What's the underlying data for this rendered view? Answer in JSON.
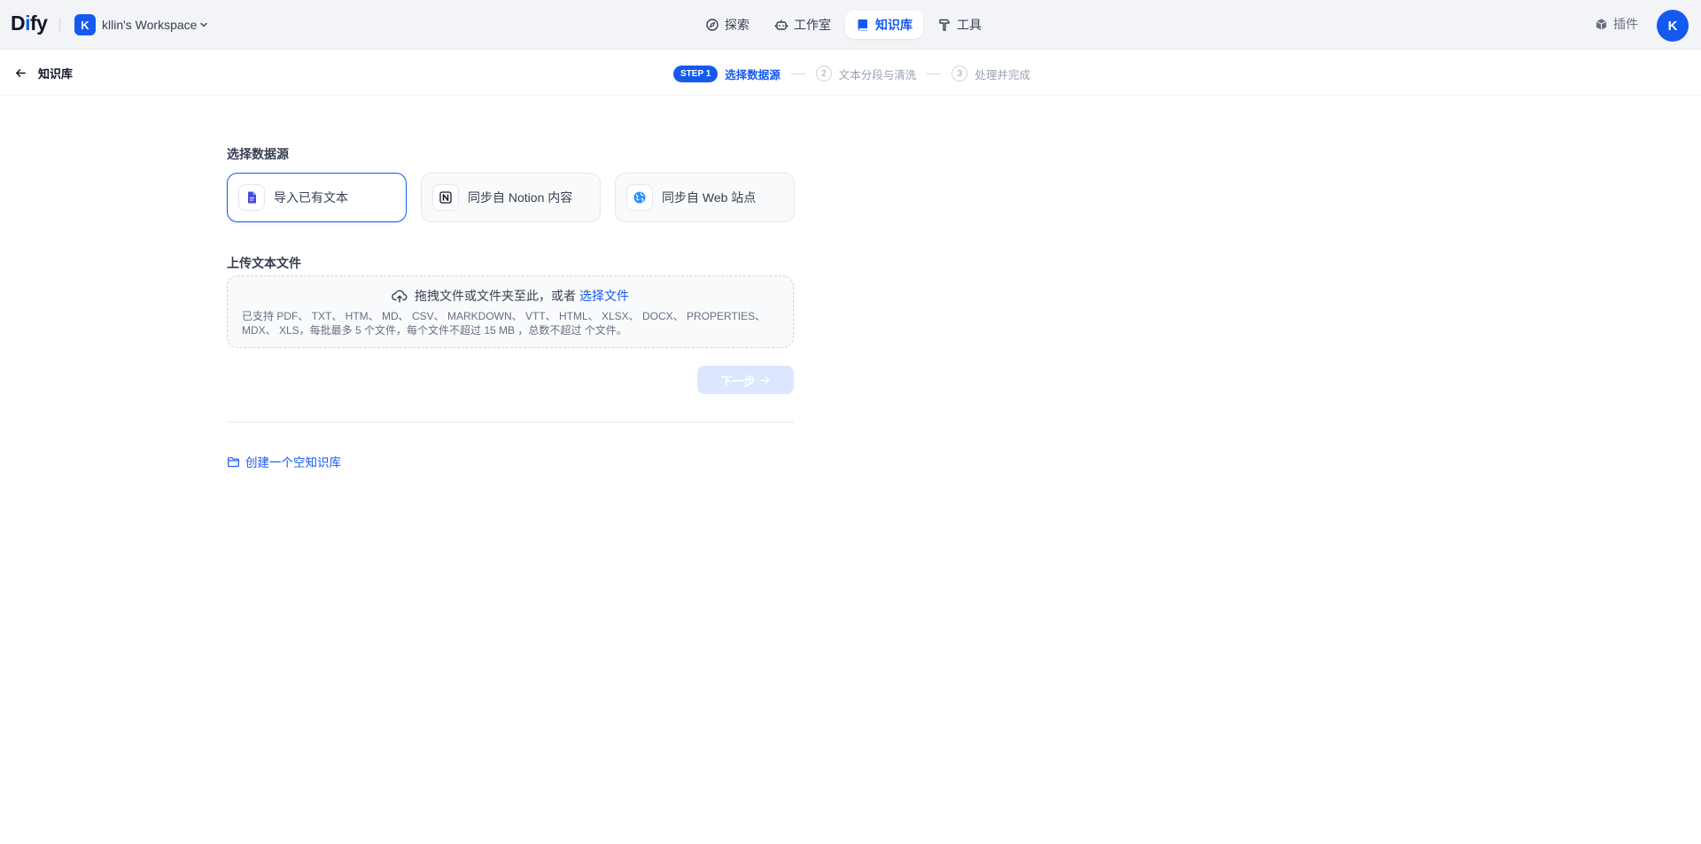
{
  "header": {
    "logo": {
      "prefix": "D",
      "accent": "i",
      "suffix": "fy"
    },
    "workspace": {
      "initial": "K",
      "name": "kllin's Workspace"
    },
    "nav": [
      {
        "id": "explore",
        "label": "探索",
        "icon": "compass-icon",
        "active": false
      },
      {
        "id": "studio",
        "label": "工作室",
        "icon": "robot-icon",
        "active": false
      },
      {
        "id": "datasets",
        "label": "知识库",
        "icon": "book-icon",
        "active": true
      },
      {
        "id": "tools",
        "label": "工具",
        "icon": "hammer-icon",
        "active": false
      }
    ],
    "plugins_label": "插件",
    "user_initial": "K"
  },
  "subheader": {
    "back_label": "知识库",
    "steps": {
      "step1_badge": "STEP 1",
      "step1_label": "选择数据源",
      "step2_num": "2",
      "step2_label": "文本分段与清洗",
      "step3_num": "3",
      "step3_label": "处理并完成"
    }
  },
  "main": {
    "datasource_title": "选择数据源",
    "sources": [
      {
        "label": "导入已有文本",
        "icon": "file-text-icon",
        "active": true
      },
      {
        "label": "同步自 Notion 内容",
        "icon": "notion-icon",
        "active": false
      },
      {
        "label": "同步自 Web 站点",
        "icon": "globe-icon",
        "active": false
      }
    ],
    "upload_title": "上传文本文件",
    "dropzone": {
      "prompt": "拖拽文件或文件夹至此，或者",
      "link": "选择文件",
      "tip": "已支持 PDF、 TXT、 HTM、 MD、 CSV、 MARKDOWN、 VTT、 HTML、 XLSX、 DOCX、 PROPERTIES、 MDX、 XLS，每批最多 5 个文件，每个文件不超过 15 MB ，总数不超过 个文件。"
    },
    "next_button": "下一步",
    "create_empty": "创建一个空知识库"
  },
  "colors": {
    "accent": "#155aef",
    "header_bg": "#f2f4f7",
    "text_primary": "#101828",
    "text_secondary": "#676f83"
  }
}
